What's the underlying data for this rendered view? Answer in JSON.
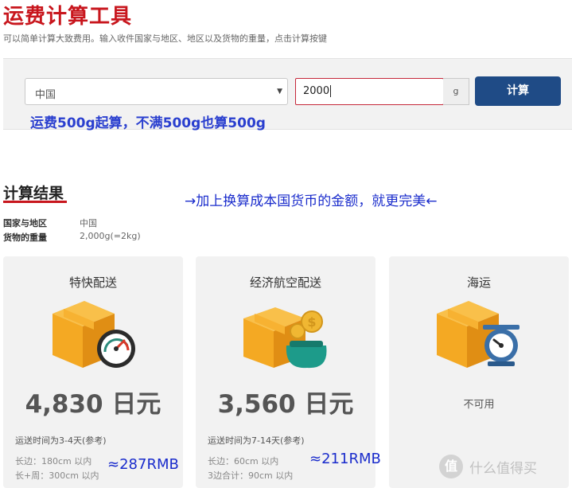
{
  "header": {
    "title": "运费计算工具",
    "subtitle": "可以简单计算大致费用。输入收件国家与地区、地区以及货物的重量，点击计算按键"
  },
  "form": {
    "country_value": "中国",
    "weight_value": "2000",
    "unit": "g",
    "calc_label": "计算"
  },
  "annotations": {
    "min_weight_note": "运费500g起算，不满500g也算500g",
    "perfect_note": "→加上换算成本国货币的金额，就更完美←",
    "rmb_card1": "≈287RMB",
    "rmb_card2": "≈211RMB"
  },
  "result": {
    "heading": "计算结果",
    "country_label": "国家与地区",
    "country_value": "中国",
    "weight_label": "货物的重量",
    "weight_value": "2,000g(=2kg)"
  },
  "cards": [
    {
      "title": "特快配送",
      "icon": "box-speedometer-icon",
      "price": "4,830 日元",
      "time": "运送时间为3-4天(参考)",
      "line1": "长边：180cm 以内",
      "line2": "长+周：300cm 以内"
    },
    {
      "title": "经济航空配送",
      "icon": "box-moneybag-icon",
      "price": "3,560 日元",
      "time": "运送时间为7-14天(参考)",
      "line1": "长边：60cm 以内",
      "line2": "3边合计：90cm 以内"
    },
    {
      "title": "海运",
      "icon": "box-scale-icon",
      "unavailable": "不可用"
    }
  ],
  "watermark": {
    "symbol": "值",
    "text": "什么值得买"
  },
  "colors": {
    "brand_red": "#c8161d",
    "button_blue": "#1f4b86",
    "note_blue": "#2a3fcf",
    "box_orange": "#f4a923",
    "teal": "#1d9b8a"
  }
}
